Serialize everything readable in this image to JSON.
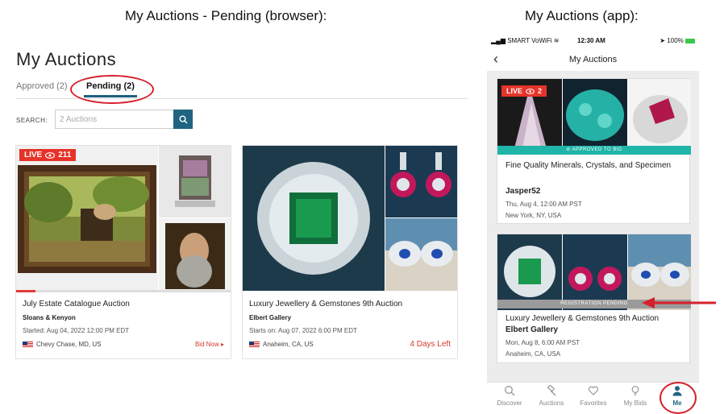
{
  "headings": {
    "left": "My Auctions - Pending (browser):",
    "right": "My Auctions (app):"
  },
  "browser": {
    "title": "My Auctions",
    "tabs": [
      {
        "label": "Approved (2)",
        "active": false
      },
      {
        "label": "Pending (2)",
        "active": true
      }
    ],
    "search": {
      "label": "SEARCH:",
      "placeholder": "2 Auctions",
      "icon": "search-icon"
    },
    "cards": [
      {
        "live_label": "LIVE",
        "viewers": "211",
        "progress": 0.09,
        "title": "July Estate Catalogue Auction",
        "house": "Sloans & Kenyon",
        "date": "Started: Aug 04, 2022 12:00 PM EDT",
        "location": "Chevy Chase, MD, US",
        "action": "Bid Now ▸"
      },
      {
        "title": "Luxury Jewellery & Gemstones 9th Auction",
        "house": "Elbert Gallery",
        "date": "Starts on: Aug 07, 2022 6:00 PM EDT",
        "location": "Anaheim, CA, US",
        "action": "4 Days Left"
      }
    ]
  },
  "app": {
    "status_bar": {
      "carrier": "SMART VoWiFi",
      "time": "12:30 AM",
      "battery": "100%"
    },
    "nav_title": "My Auctions",
    "back_icon": "chevron-left-icon",
    "cards": [
      {
        "live_label": "LIVE",
        "viewers": "2",
        "band": "APPROVED TO BID",
        "title": "Fine Quality Minerals, Crystals, and Specimen",
        "house": "Jasper52",
        "date": "Thu, Aug 4, 12:00 AM PST",
        "location": "New York, NY, USA"
      },
      {
        "band": "REGISTRATION PENDING",
        "title": "Luxury Jewellery & Gemstones 9th Auction",
        "house": "Elbert Gallery",
        "date": "Mon, Aug 8, 6:00 AM PST",
        "location": "Anaheim, CA, USA"
      }
    ],
    "tab_bar": [
      {
        "label": "Discover",
        "icon": "search-icon"
      },
      {
        "label": "Auctions",
        "icon": "gavel-icon"
      },
      {
        "label": "Favorites",
        "icon": "heart-icon"
      },
      {
        "label": "My Bids",
        "icon": "bulb-icon"
      },
      {
        "label": "Me",
        "icon": "person-icon",
        "active": true
      }
    ]
  },
  "colors": {
    "accent": "#1f6480",
    "live_red": "#e6332a",
    "annotation_red": "#d8202c",
    "approved_teal": "#1fb5a8",
    "pending_gray": "#9a9a9a"
  }
}
